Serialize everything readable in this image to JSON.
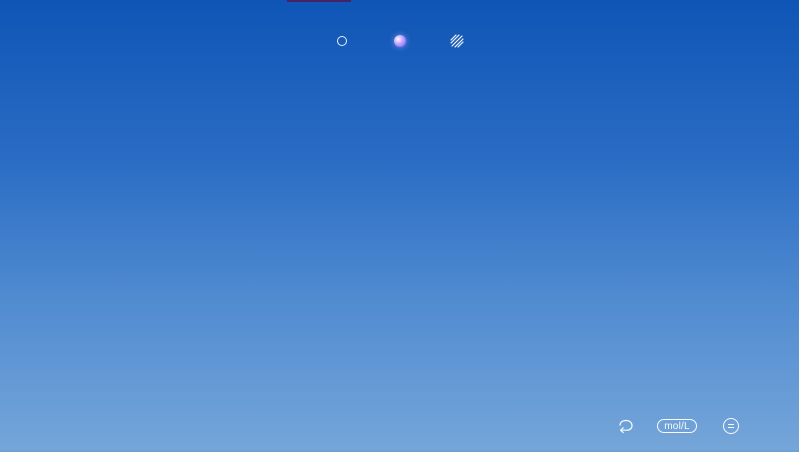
{
  "modes": [
    {
      "name": "wireframe",
      "icon": "ring-icon"
    },
    {
      "name": "solid",
      "icon": "sphere-icon"
    },
    {
      "name": "hatched",
      "icon": "hatch-icon"
    }
  ],
  "bottom_bar": {
    "undo_icon": "undo-icon",
    "unit_label": "mol/L",
    "menu_icon": "menu-icon"
  },
  "colors": {
    "background_top": "#0f55b6",
    "background_bottom": "#75a6d9",
    "accent_sphere": "#9b7cff",
    "top_accent": "#4a1d5a",
    "foreground": "#ffffff"
  }
}
